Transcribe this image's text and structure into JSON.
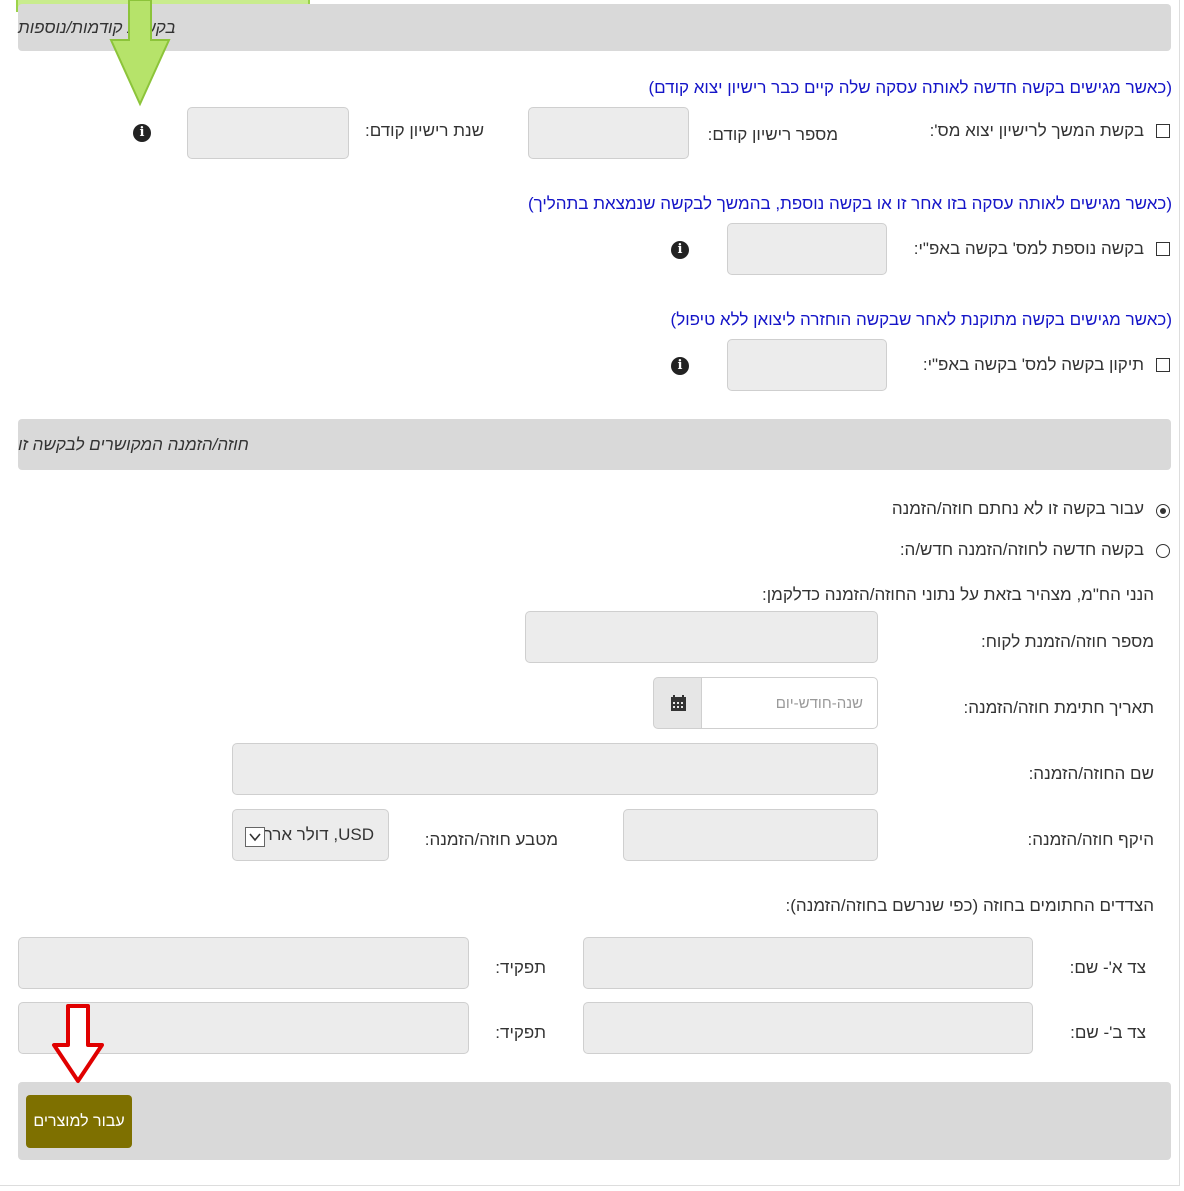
{
  "sections": {
    "previous_requests": {
      "title": "בקשות קודמות/נוספות",
      "note1": "(כאשר מגישים בקשה חדשה לאותה עסקה שלה קיים כבר רישיון יצוא קודם)",
      "continuation_label": "בקשת המשך לרישיון יצוא מס':",
      "prev_license_number_label": "מספר רישיון קודם:",
      "prev_license_year_label": "שנת רישיון קודם:",
      "note2": "(כאשר מגישים לאותה עסקה בזו אחר זו או בקשה נוספת, בהמשך לבקשה שנמצאת בתהליך)",
      "additional_request_label": "בקשה נוספת למס' בקשה באפ\"י:",
      "note3": "(כאשר מגישים בקשה מתוקנת לאחר שבקשה הוחזרה ליצואן ללא טיפול)",
      "amend_request_label": "תיקון בקשה למס' בקשה באפ\"י:"
    },
    "contract": {
      "title": "חוזה/הזמנה המקושרים לבקשה זו",
      "radio_no_contract": "עבור בקשה זו לא נחתם חוזה/הזמנה",
      "radio_new_contract": "בקשה חדשה לחוזה/הזמנה חדש/ה:",
      "declaration": "הנני הח\"מ, מצהיר בזאת על נתוני החוזה/הזמנה כדלקמן:",
      "customer_order_number_label": "מספר חוזה/הזמנת לקוח:",
      "signing_date_label": "תאריך חתימת חוזה/הזמנה:",
      "date_placeholder": "שנה-חודש-יום",
      "contract_name_label": "שם החוזה/הזמנה:",
      "contract_scope_label": "היקף חוזה/הזמנה:",
      "currency_label": "מטבע חוזה/הזמנה:",
      "currency_value": "USD, דולר ארה\"ב",
      "parties_label": "הצדדים החתומים בחוזה (כפי שנרשם בחוזה/הזמנה):",
      "party_a_name_label": "צד א'- שם:",
      "party_b_name_label": "צד ב'- שם:",
      "role_label": "תפקיד:"
    }
  },
  "actions": {
    "submit_label": "עבור למוצרים"
  },
  "icons": {
    "info": "info-icon",
    "calendar": "calendar-icon",
    "chevron": "chevron-down-icon",
    "annotation_top": "green-down-arrow-icon",
    "annotation_bottom": "red-down-arrow-icon"
  },
  "colors": {
    "note_text": "#1515c8",
    "section_bar": "#d9d9d9",
    "submit_button": "#7e7000",
    "annotation_green": "#b6e36a",
    "annotation_red": "#e00000"
  }
}
